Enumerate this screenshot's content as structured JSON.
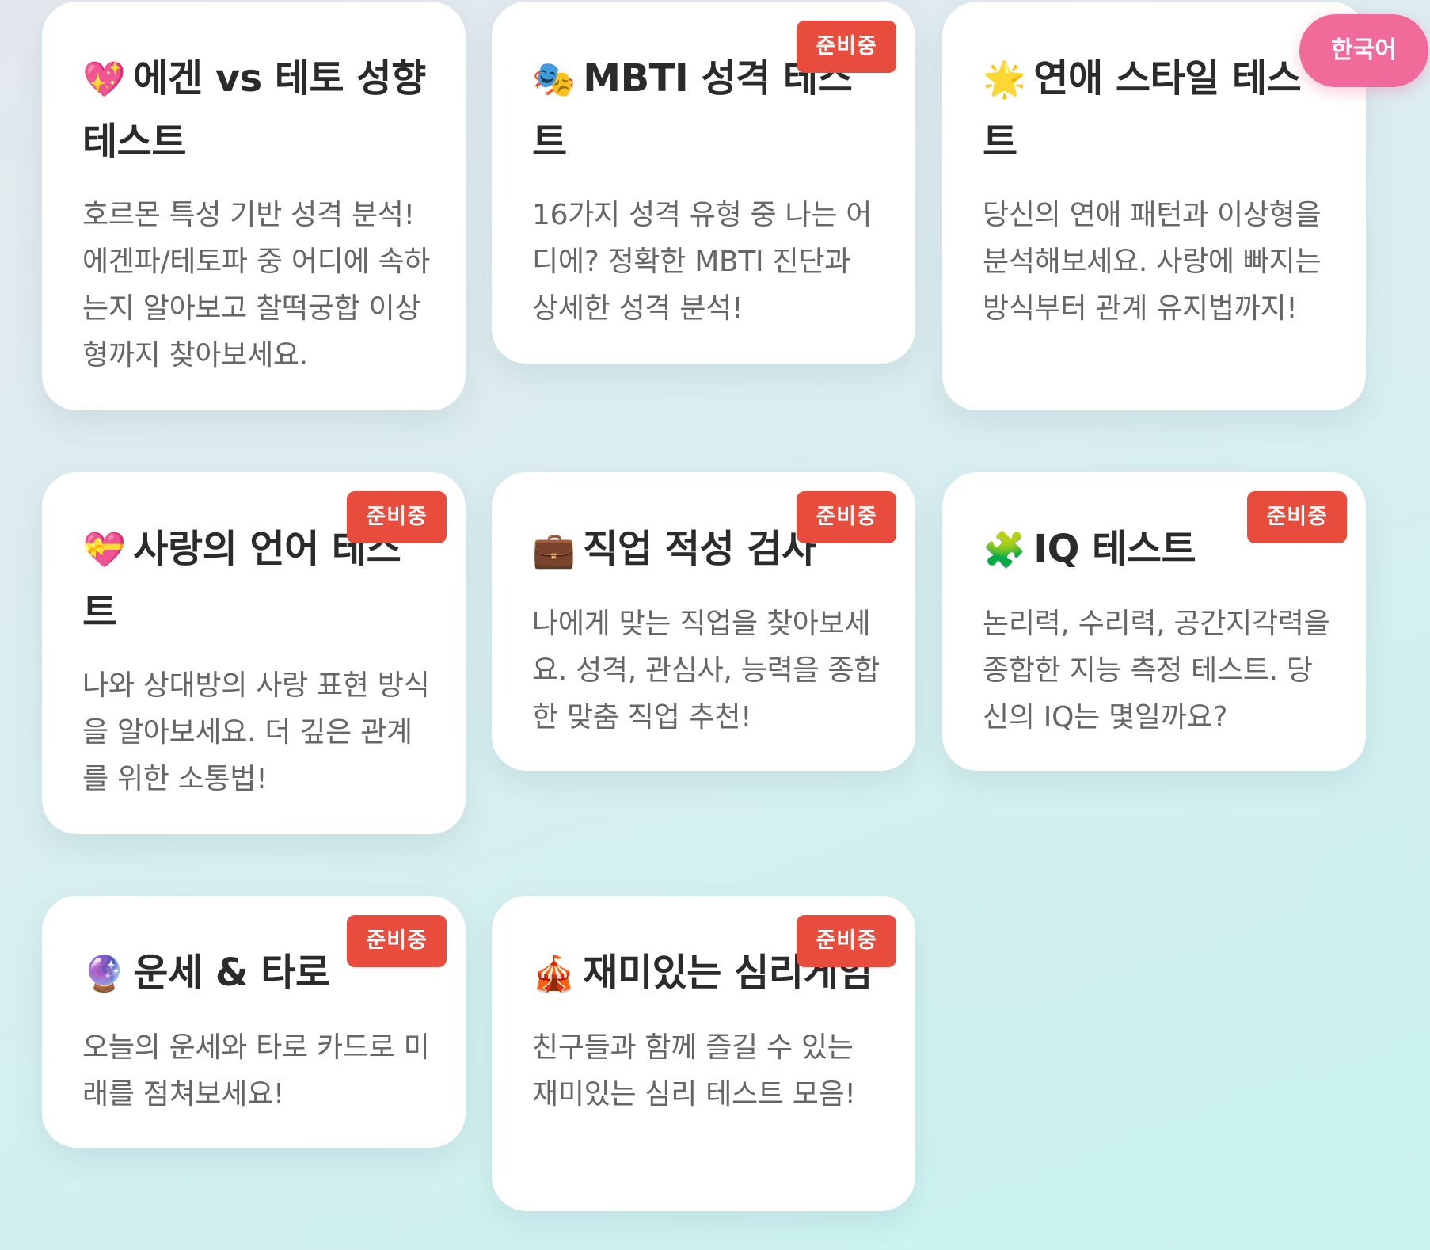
{
  "language_button": {
    "label": "한국어",
    "color": "#f06b9a"
  },
  "badge_color": "#e74c3c",
  "cards": [
    {
      "icon": "💖",
      "icon_name": "sparkling-heart-icon",
      "title": "에겐 vs 테토 성향 테스트",
      "description": "호르몬 특성 기반 성격 분석! 에겐파/테토파 중 어디에 속하는지 알아보고 찰떡궁합 이상형까지 찾아보세요.",
      "badge": ""
    },
    {
      "icon": "🎭",
      "icon_name": "theater-masks-icon",
      "title": "MBTI 성격 테스트",
      "description": "16가지 성격 유형 중 나는 어디에? 정확한 MBTI 진단과 상세한 성격 분석!",
      "badge": "준비중"
    },
    {
      "icon": "🌟",
      "icon_name": "glowing-star-icon",
      "title": "연애 스타일 테스트",
      "description": "당신의 연애 패턴과 이상형을 분석해보세요. 사랑에 빠지는 방식부터 관계 유지법까지!",
      "badge": ""
    },
    {
      "icon": "💝",
      "icon_name": "heart-with-ribbon-icon",
      "title": "사랑의 언어 테스트",
      "description": "나와 상대방의 사랑 표현 방식을 알아보세요. 더 깊은 관계를 위한 소통법!",
      "badge": "준비중"
    },
    {
      "icon": "💼",
      "icon_name": "briefcase-icon",
      "title": "직업 적성 검사",
      "description": "나에게 맞는 직업을 찾아보세요. 성격, 관심사, 능력을 종합한 맞춤 직업 추천!",
      "badge": "준비중"
    },
    {
      "icon": "🧩",
      "icon_name": "puzzle-piece-icon",
      "title": "IQ 테스트",
      "description": "논리력, 수리력, 공간지각력을 종합한 지능 측정 테스트. 당신의 IQ는 몇일까요?",
      "badge": "준비중"
    },
    {
      "icon": "🔮",
      "icon_name": "crystal-ball-icon",
      "title": "운세 & 타로",
      "description": "오늘의 운세와 타로 카드로 미래를 점쳐보세요!",
      "badge": "준비중"
    },
    {
      "icon": "🎪",
      "icon_name": "circus-tent-icon",
      "title": "재미있는 심리게임",
      "description": "친구들과 함께 즐길 수 있는 재미있는 심리 테스트 모음!",
      "badge": "준비중"
    }
  ]
}
